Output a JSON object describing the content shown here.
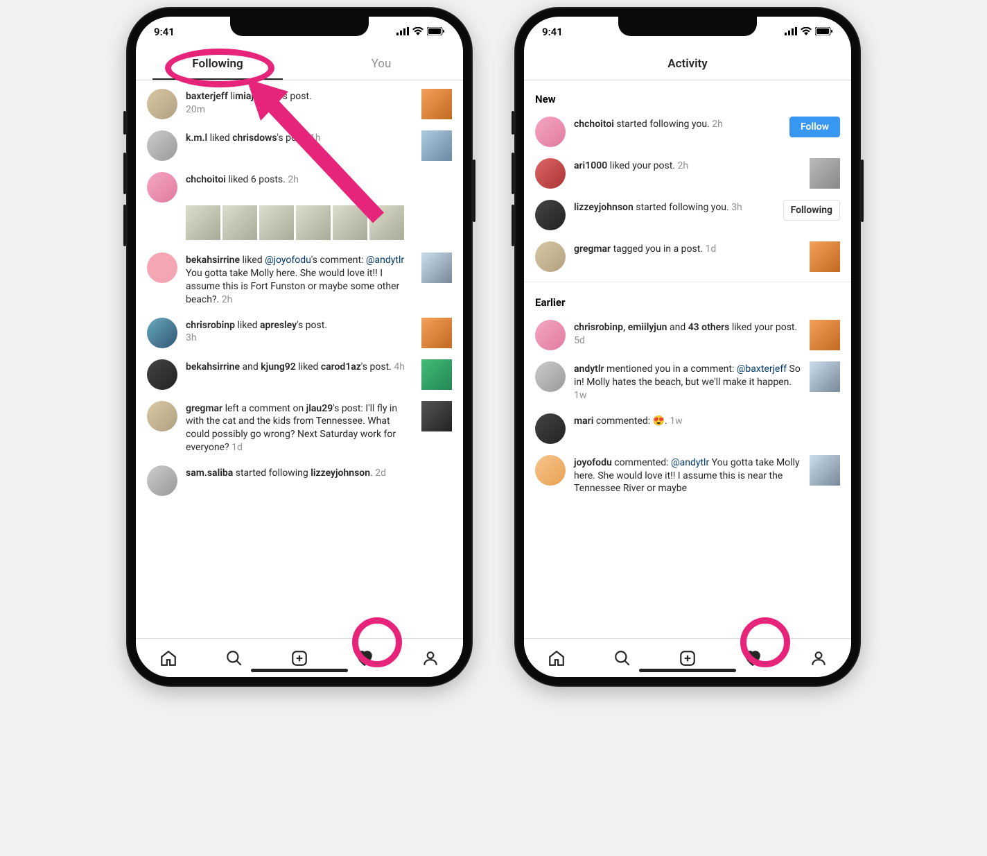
{
  "statusbar": {
    "time": "9:41"
  },
  "annotations": {
    "circle_following": true,
    "arrow_to_following": true,
    "circle_heart_left": true,
    "circle_heart_right": true
  },
  "left": {
    "tabs": {
      "following": "Following",
      "you": "You"
    },
    "items": [
      {
        "user": "baxterjeff",
        "text_mid": " li",
        "mention": "miajaywee",
        "text_after": "'s post.",
        "time": " 20m"
      },
      {
        "user": "k.m.l",
        "text_mid": " liked ",
        "bold2": "chrisdows",
        "text_after": "'s post.",
        "time": " 1h"
      },
      {
        "user": "chchoitoi",
        "text_mid": " liked 6 posts.",
        "time": " 2h",
        "grid": 6
      },
      {
        "user": "bekahsirrine",
        "text_mid": " liked ",
        "mention": "@joyofodu",
        "text_after": "'s comment: ",
        "mention2": "@andytlr",
        "comment": " You gotta take Molly here. She would love it!! I assume this is Fort Funston or maybe some other beach?.",
        "time": " 2h"
      },
      {
        "user": "chrisrobinp",
        "text_mid": " liked ",
        "bold2": "apresley",
        "text_after": "'s post.",
        "time": " 3h"
      },
      {
        "user": "bekahsirrine",
        "text_mid": " and ",
        "bold2": "kjung92",
        "text_after": " liked ",
        "bold3": "carod1az",
        "text_after2": "'s post.",
        "time": " 4h"
      },
      {
        "user": "gregmar",
        "text_mid": " left a comment on ",
        "bold2": "jlau29",
        "text_after": "'s post:  I'll fly in with the cat and the kids from Tennessee. What could possibly go wrong? Next Saturday work for everyone?",
        "time": " 1d"
      },
      {
        "user": "sam.saliba",
        "text_mid": " started following ",
        "bold2": "lizzeyjohnson",
        "text_after": ".",
        "time": " 2d"
      }
    ]
  },
  "right": {
    "title": "Activity",
    "sections": {
      "new": "New",
      "earlier": "Earlier"
    },
    "new_items": [
      {
        "user": "chchoitoi",
        "text": " started following you.",
        "time": " 2h",
        "action": "follow",
        "action_label": "Follow"
      },
      {
        "user": "ari1000",
        "text": " liked your post.",
        "time": " 2h",
        "thumb": "grey"
      },
      {
        "user": "lizzeyjohnson",
        "text": " started following you.",
        "time": " 3h",
        "action": "following",
        "action_label": "Following"
      },
      {
        "user": "gregmar",
        "text": " tagged you in a post.",
        "time": " 1d",
        "thumb": "orange"
      }
    ],
    "earlier_items": [
      {
        "user": "chrisrobinp, emiilyjun",
        "text_mid": " and ",
        "bold2": "43 others",
        "text_after": " liked your post.",
        "time": " 5d",
        "thumb": "orange"
      },
      {
        "user": "andytlr",
        "text": " mentioned you in a comment: ",
        "mention": "@baxterjeff",
        "comment": " So in! Molly hates the beach, but we'll make it happen.",
        "time": " 1w",
        "thumb": "beach"
      },
      {
        "user": "mari",
        "text": " commented: 😍.",
        "time": " 1w"
      },
      {
        "user": "joyofodu",
        "text": " commented: ",
        "mention": "@andytlr",
        "comment": " You gotta take Molly here. She would love it!! I assume this is near the Tennessee River or maybe",
        "thumb": "beach"
      }
    ]
  },
  "nav": {
    "home": "home-icon",
    "search": "search-icon",
    "add": "add-post-icon",
    "heart": "activity-heart-icon",
    "profile": "profile-icon"
  }
}
